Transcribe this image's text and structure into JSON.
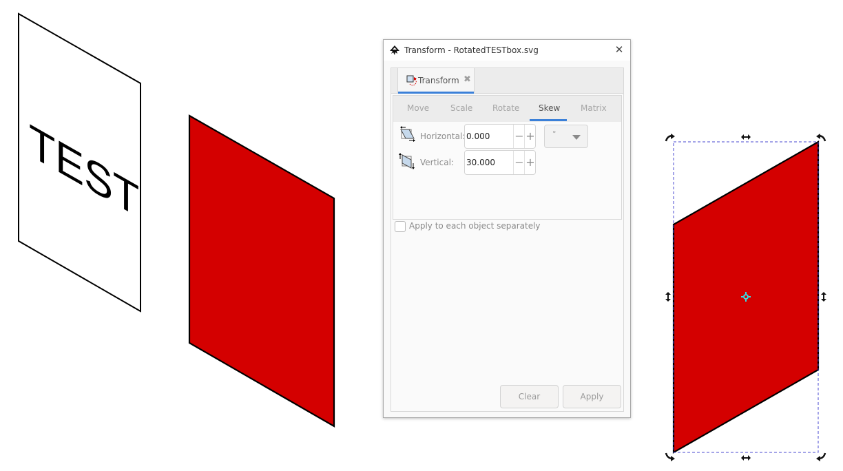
{
  "dialog": {
    "title": "Transform - RotatedTESTbox.svg",
    "close_glyph": "✕",
    "dock_tab": {
      "label": "Transform",
      "close_glyph": "✖",
      "icon": "transform-icon"
    },
    "tabs": [
      {
        "label": "Move",
        "active": false
      },
      {
        "label": "Scale",
        "active": false
      },
      {
        "label": "Rotate",
        "active": false
      },
      {
        "label": "Skew",
        "active": true
      },
      {
        "label": "Matrix",
        "active": false
      }
    ],
    "horizontal": {
      "label": "Horizontal:",
      "value": "0.000",
      "icon": "skew-horizontal-icon"
    },
    "vertical": {
      "label": "Vertical:",
      "value": "30.000",
      "icon": "skew-vertical-icon"
    },
    "unit": {
      "selected": "°"
    },
    "spin_minus": "−",
    "spin_plus": "+",
    "apply_separately": {
      "label": "Apply to each object separately",
      "checked": false
    },
    "buttons": {
      "clear": "Clear",
      "apply": "Apply"
    }
  },
  "canvas": {
    "text_object": "TEST",
    "colors": {
      "fill_red": "#d40000",
      "stroke": "#000000",
      "selection_dash": "#4a4ad0",
      "center_marker": "#33e0e8",
      "accent": "#3b80d8"
    }
  }
}
